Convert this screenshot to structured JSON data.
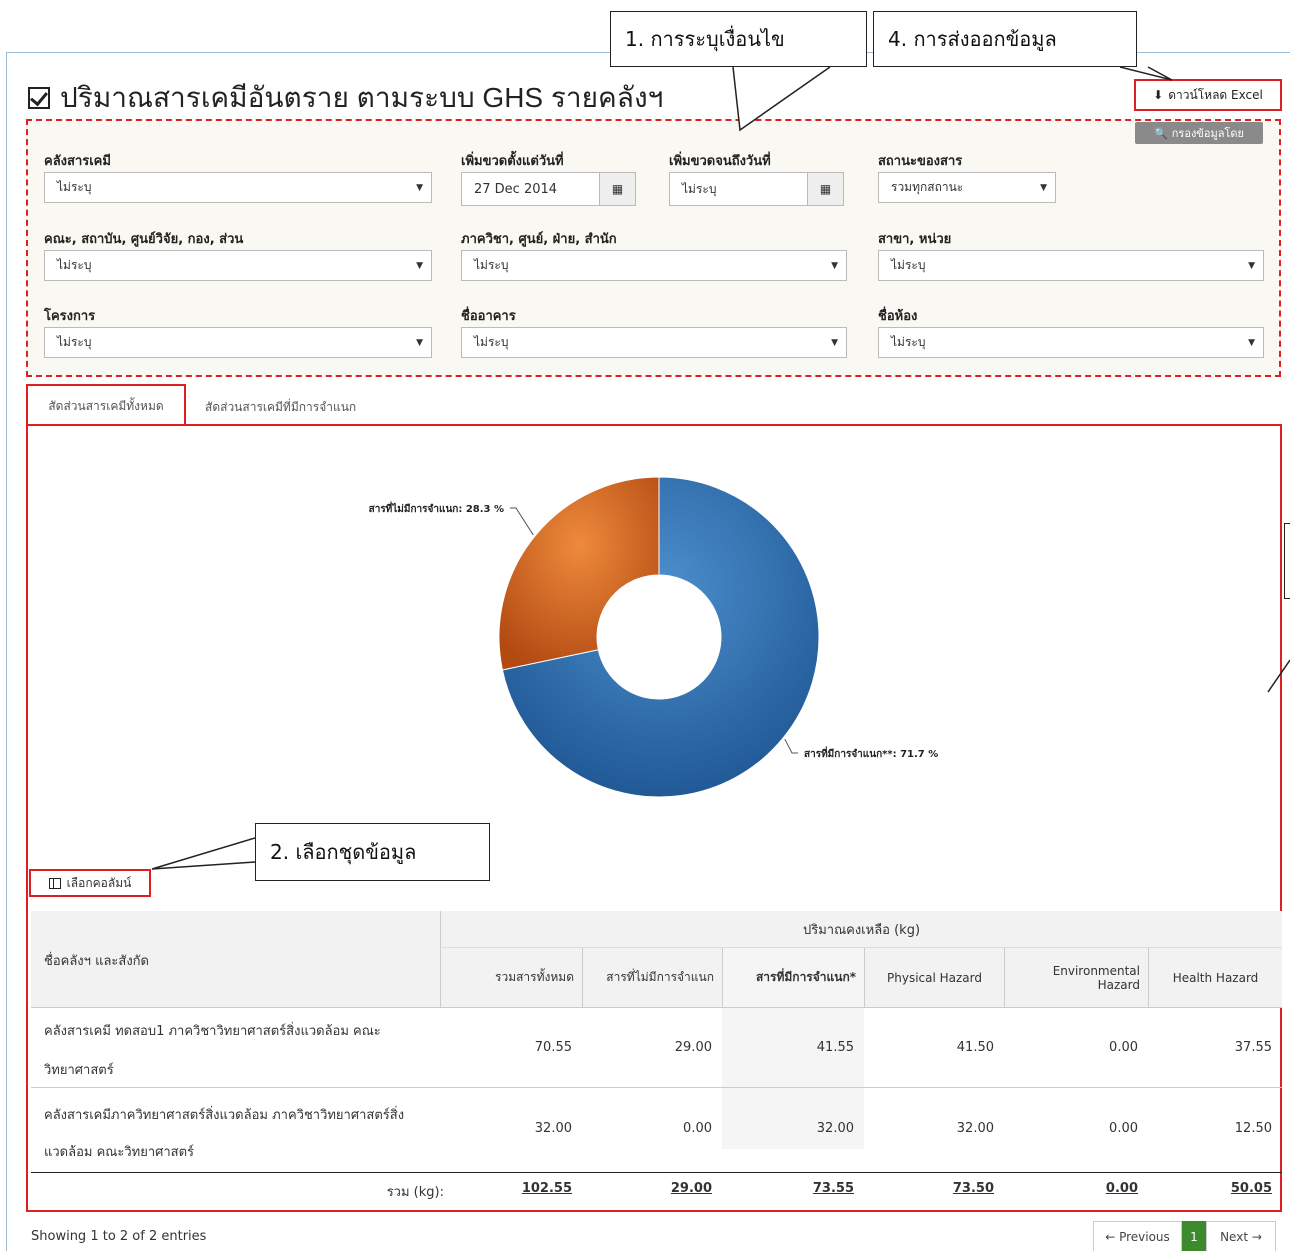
{
  "title": "ปริมาณสารเคมีอันตราย ตามระบบ GHS รายคลังฯ",
  "excel_button": "ดาวน์โหลด Excel",
  "filter_button": "กรองข้อมูลโดย",
  "filters": {
    "warehouse": {
      "label": "คลังสารเคมี",
      "value": "ไม่ระบุ"
    },
    "date_from": {
      "label": "เพิ่มขวดตั้งแต่วันที่",
      "value": "27 Dec 2014"
    },
    "date_to": {
      "label": "เพิ่มขวดจนถึงวันที่",
      "value": "ไม่ระบุ"
    },
    "status": {
      "label": "สถานะของสาร",
      "value": "รวมทุกสถานะ"
    },
    "faculty": {
      "label": "คณะ, สถาบัน, ศูนย์วิจัย, กอง, ส่วน",
      "value": "ไม่ระบุ"
    },
    "department": {
      "label": "ภาควิชา, ศูนย์, ฝ่าย, สำนัก",
      "value": "ไม่ระบุ"
    },
    "branch": {
      "label": "สาขา, หน่วย",
      "value": "ไม่ระบุ"
    },
    "project": {
      "label": "โครงการ",
      "value": "ไม่ระบุ"
    },
    "building": {
      "label": "ชื่ออาคาร",
      "value": "ไม่ระบุ"
    },
    "room": {
      "label": "ชื่อห้อง",
      "value": "ไม่ระบุ"
    }
  },
  "tabs": [
    "สัดส่วนสารเคมีทั้งหมด",
    "สัดส่วนสารเคมีที่มีการจำแนก"
  ],
  "callouts": {
    "c1": "1. การระบุเงื่อนไข",
    "c2": "2. เลือกชุดข้อมูล",
    "c4": "4. การส่งออกข้อมูล"
  },
  "chart_data": {
    "type": "pie",
    "categories": [
      "สารที่มีการจำแนก**",
      "สารที่ไม่มีการจำแนก"
    ],
    "values": [
      71.7,
      28.3
    ],
    "labels": [
      "สารที่มีการจำแนก**: 71.7 %",
      "สารที่ไม่มีการจำแนก: 28.3 %"
    ],
    "colors": [
      "#2e6aa8",
      "#d8661f"
    ],
    "donut": true
  },
  "columns_button": "เลือกคอลัมน์",
  "table": {
    "group_header": "ปริมาณคงเหลือ (kg)",
    "first_header": "ชื่อคลังฯ และสังกัด",
    "headers": [
      "รวมสารทั้งหมด",
      "สารที่ไม่มีการจำแนก",
      "สารที่มีการจำแนก*",
      "Physical Hazard",
      "Environmental Hazard",
      "Health Hazard"
    ],
    "rows": [
      {
        "name_line1": "คลังสารเคมี ทดสอบ1 ภาควิชาวิทยาศาสตร์สิ่งแวดล้อม คณะ",
        "name_line2": "วิทยาศาสตร์",
        "values": [
          "70.55",
          "29.00",
          "41.55",
          "41.50",
          "0.00",
          "37.55"
        ]
      },
      {
        "name_line1": "คลังสารเคมีภาควิทยาศาสตร์สิ่งแวดล้อม ภาควิชาวิทยาศาสตร์สิ่ง",
        "name_line2": "แวดล้อม คณะวิทยาศาสตร์",
        "values": [
          "32.00",
          "0.00",
          "32.00",
          "32.00",
          "0.00",
          "12.50"
        ]
      }
    ],
    "total_label": "รวม (kg):",
    "totals": [
      "102.55",
      "29.00",
      "73.55",
      "73.50",
      "0.00",
      "50.05"
    ]
  },
  "footer": {
    "info": "Showing 1 to 2 of 2 entries",
    "prev": "← Previous",
    "page": "1",
    "next": "Next →"
  }
}
